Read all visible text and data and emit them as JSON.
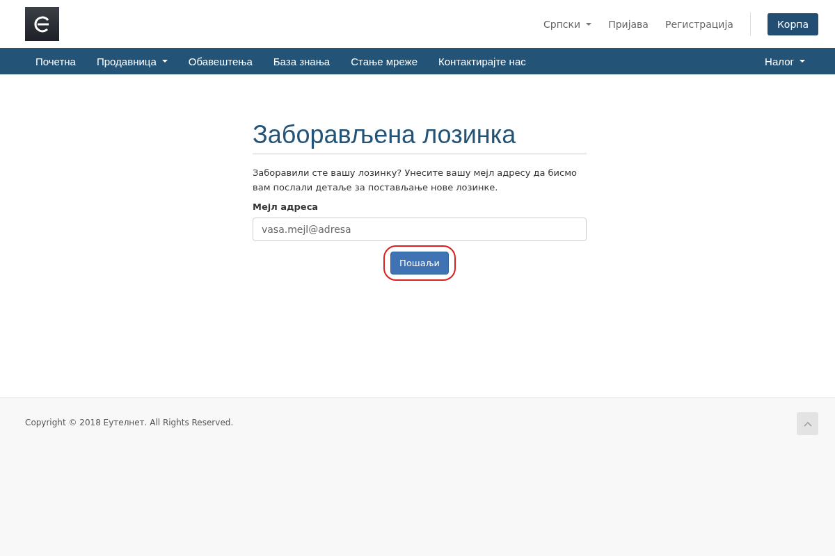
{
  "top_links": [
    {
      "label": "Српски",
      "dropdown": true
    },
    {
      "label": "Пријава",
      "dropdown": false
    },
    {
      "label": "Регистрација",
      "dropdown": false
    }
  ],
  "cart_button": "Корпа",
  "nav": [
    {
      "label": "Почетна",
      "dropdown": false
    },
    {
      "label": "Продавница",
      "dropdown": true
    },
    {
      "label": "Обавештења",
      "dropdown": false
    },
    {
      "label": "База знања",
      "dropdown": false
    },
    {
      "label": "Стање мреже",
      "dropdown": false
    },
    {
      "label": "Контактирајте нас",
      "dropdown": false
    }
  ],
  "nav_right": {
    "label": "Налог",
    "dropdown": true
  },
  "title": "Заборављена лозинка",
  "intro": "Заборавили сте вашу лозинку? Унесите вашу мејл адресу да бисмо вам послали детаље за постављање нове лозинке.",
  "email_field": {
    "label": "Мејл адреса",
    "placeholder": "vasa.mejl@adresa"
  },
  "submit": {
    "label": "Пошаљи",
    "highlighted": true
  },
  "footer": {
    "copyright": "Copyright © 2018 Еутелнет. All Rights Reserved."
  }
}
